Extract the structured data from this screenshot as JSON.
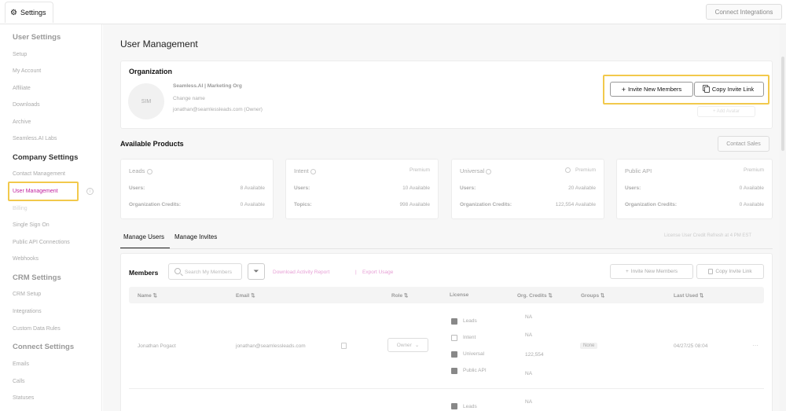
{
  "topbar": {
    "tab_label": "Settings",
    "connect_integrations": "Connect Integrations"
  },
  "sidebar": {
    "user_settings": {
      "heading": "User Settings",
      "items": [
        "Setup",
        "My Account",
        "Affiliate",
        "Downloads",
        "Archive",
        "Seamless.AI Labs"
      ]
    },
    "company_settings": {
      "heading": "Company Settings",
      "items": [
        "Contact Management",
        "User Management",
        "Billing",
        "Single Sign On",
        "Public API Connections",
        "Webhooks"
      ]
    },
    "crm_settings": {
      "heading": "CRM Settings",
      "items": [
        "CRM Setup",
        "Integrations",
        "Custom Data Rules"
      ]
    },
    "connect_settings": {
      "heading": "Connect Settings",
      "items": [
        "Emails",
        "Calls",
        "Statuses"
      ]
    },
    "active_item": "User Management"
  },
  "page": {
    "title": "User Management"
  },
  "organization": {
    "title": "Organization",
    "avatar_initials": "SIM",
    "name": "Seamless.AI | Marketing Org",
    "change_name": "Change name",
    "owner_email": "jonathan@seamlessleads.com (Owner)",
    "invite_button": "Invite New Members",
    "copy_button": "Copy Invite Link",
    "add_avatar": "+ Add Avatar"
  },
  "products": {
    "title": "Available Products",
    "contact_sales": "Contact Sales",
    "items": [
      {
        "name": "Leads",
        "badge": "",
        "row1_label": "Users:",
        "row1_value": "8 Available",
        "row2_label": "Organization Credits:",
        "row2_value": "0 Available"
      },
      {
        "name": "Intent",
        "badge": "Premium",
        "row1_label": "Users:",
        "row1_value": "10 Available",
        "row2_label": "Topics:",
        "row2_value": "998 Available"
      },
      {
        "name": "Universal",
        "badge": "Premium",
        "row1_label": "Users:",
        "row1_value": "20 Available",
        "row2_label": "Organization Credits:",
        "row2_value": "122,554 Available"
      },
      {
        "name": "Public API",
        "badge": "Premium",
        "row1_label": "Users:",
        "row1_value": "0 Available",
        "row2_label": "Organization Credits:",
        "row2_value": "0 Available"
      }
    ]
  },
  "tabs": {
    "manage_users": "Manage Users",
    "manage_invites": "Manage Invites",
    "refresh_note": "License User Credit Refresh at 4 PM EST"
  },
  "members": {
    "title": "Members",
    "search_placeholder": "Search My Members",
    "download_report": "Download Activity Report",
    "divider": "|",
    "export_usage": "Export Usage",
    "invite_button": "Invite New Members",
    "copy_button": "Copy Invite Link",
    "columns": [
      "Name",
      "Email",
      "Role",
      "License",
      "Org. Credits",
      "Groups",
      "Last Used"
    ],
    "rows": [
      {
        "name": "Jonathan Pogact",
        "email": "jonathan@seamlessleads.com",
        "role": "Owner",
        "licenses": [
          {
            "label": "Leads",
            "checked": true,
            "credits": "NA"
          },
          {
            "label": "Intent",
            "checked": false,
            "credits": "NA"
          },
          {
            "label": "Universal",
            "checked": true,
            "credits": "122,554"
          },
          {
            "label": "Public API",
            "checked": true,
            "credits": "NA"
          }
        ],
        "group": "None",
        "last_used": "04/27/25 08:04"
      },
      {
        "licenses": [
          {
            "label": "Leads",
            "checked": true,
            "credits": "NA"
          }
        ]
      }
    ]
  }
}
